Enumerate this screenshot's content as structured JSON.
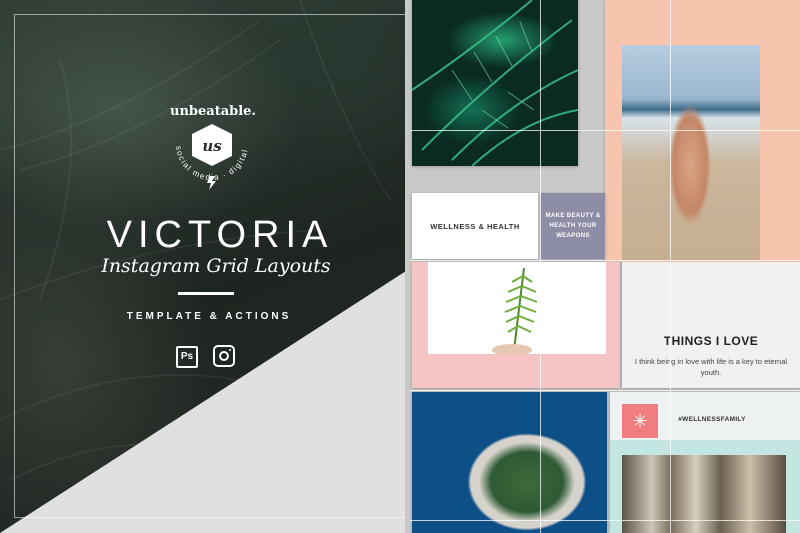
{
  "brand": {
    "name": "unbeatable.",
    "ring_text": "social media · digital tools",
    "monogram": "us"
  },
  "product": {
    "title": "VICTORIA",
    "subtitle": "Instagram Grid Layouts",
    "tagline": "TEMPLATE & ACTIONS"
  },
  "icons": {
    "photoshop": "photoshop-icon",
    "photoshop_label": "Ps",
    "instagram": "instagram-icon",
    "snowflake": "snowflake-icon"
  },
  "grid": {
    "wellness_label": "WELLNESS & HEALTH",
    "beauty_label": "MAKE BEAUTY & HEALTH YOUR WEAPONS",
    "things_title": "THINGS I LOVE",
    "things_body": "I think being in love with life is a key to eternal youth.",
    "hashtag": "#WELLNESSFAMILY",
    "snowflake_glyph": "✳"
  },
  "colors": {
    "peach": "#f7c5ad",
    "lavender": "#8e8da6",
    "pink": "#f5c5c5",
    "coral": "#f07e7e",
    "mint": "#c4e6e3"
  }
}
